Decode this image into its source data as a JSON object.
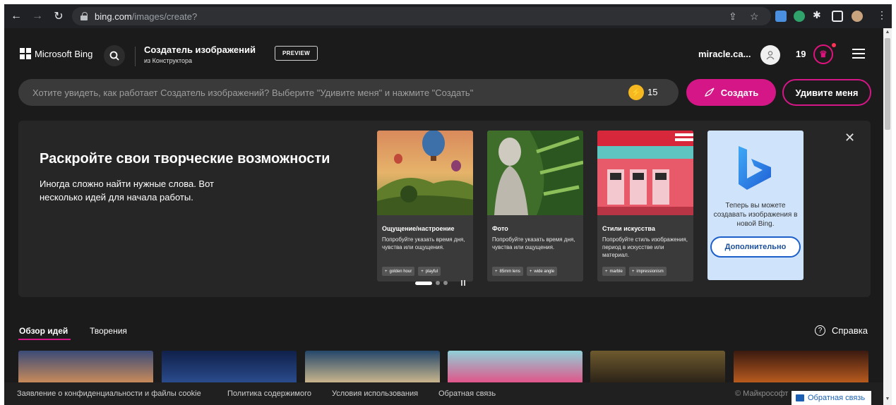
{
  "browser": {
    "url_host": "bing.com",
    "url_path": "/images/create?"
  },
  "header": {
    "brand": "Microsoft Bing",
    "title": "Создатель изображений",
    "subtitle": "из Конструктора",
    "preview_badge": "PREVIEW",
    "username": "miracle.ca...",
    "rewards_count": "19"
  },
  "prompt": {
    "placeholder": "Хотите увидеть, как работает Создатель изображений? Выберите \"Удивите меня\" и нажмите \"Создать\"",
    "boosts": "15",
    "create_label": "Создать",
    "surprise_label": "Удивите меня"
  },
  "banner": {
    "title": "Раскройте свои творческие возможности",
    "description": "Иногда сложно найти нужные слова. Вот несколько идей для начала работы.",
    "cards": [
      {
        "heading": "Ощущение/настроение",
        "body": "Попробуйте указать время дня, чувства или ощущения.",
        "chips": [
          "golden hour",
          "playful"
        ]
      },
      {
        "heading": "Фото",
        "body": "Попробуйте указать время дня, чувства или ощущения.",
        "chips": [
          "85mm lens",
          "wide angle"
        ]
      },
      {
        "heading": "Стили искусства",
        "body": "Попробуйте стиль изображения, период в искусстве или материал.",
        "chips": [
          "marble",
          "impressionism"
        ]
      }
    ],
    "bing_card": {
      "text": "Теперь вы можете создавать изображения в новой Bing.",
      "button": "Дополнительно"
    }
  },
  "tabs": {
    "ideas": "Обзор идей",
    "creations": "Творения",
    "help": "Справка"
  },
  "footer": {
    "privacy": "Заявление о конфиденциальности и файлы cookie",
    "content_policy": "Политика содержимого",
    "terms": "Условия использования",
    "feedback": "Обратная связь",
    "copyright": "© Майкрософт",
    "feedback_float": "Обратная связь"
  },
  "colors": {
    "accent": "#d51687",
    "page_bg": "#1b1b1b",
    "banner_bg": "#262626"
  }
}
